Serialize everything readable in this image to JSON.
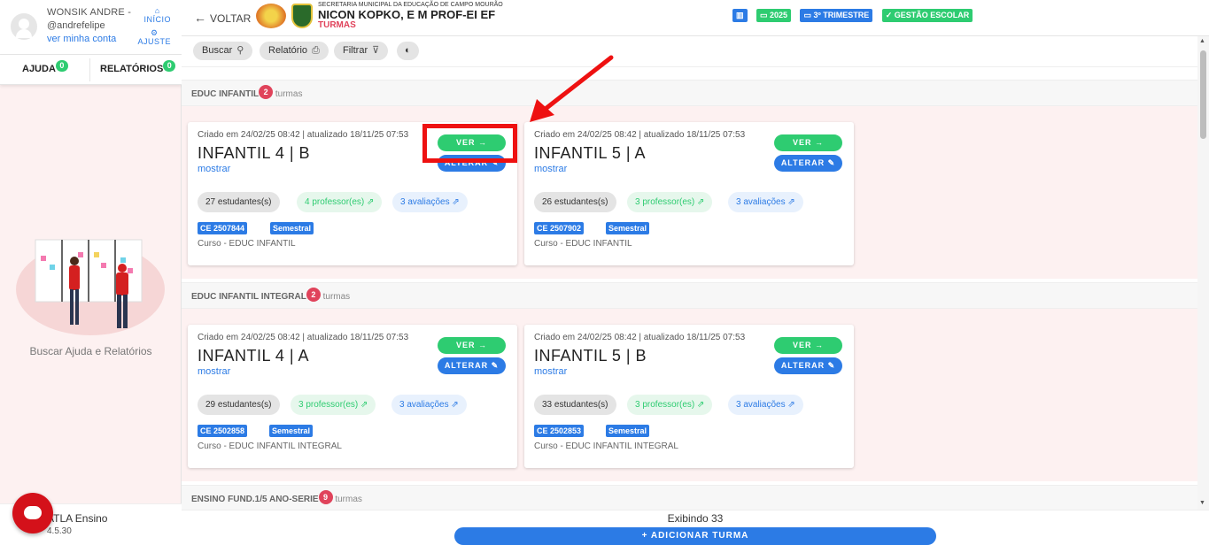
{
  "user": {
    "name": "WONSIK ANDRE -",
    "handle": "@andrefelipe",
    "profile_link": "ver minha conta"
  },
  "quick_links": {
    "home": "INÍCIO",
    "settings": "AJUSTE"
  },
  "sidebar_tabs": {
    "help": "AJUDA",
    "help_count": "0",
    "reports": "RELATÓRIOS",
    "reports_count": "0"
  },
  "help_text": "Buscar Ajuda e Relatórios",
  "app": {
    "name": "ATLA Ensino",
    "version": "4.5.30"
  },
  "header": {
    "back": "VOLTAR",
    "secretaria": "SECRETARIA MUNICIPAL DA EDUCAÇÃO DE CAMPO MOURÃO",
    "school": "NICON KOPKO, E M PROF-EI EF",
    "subtitle": "TURMAS",
    "chips": {
      "year": "2025",
      "term": "3º TRIMESTRE",
      "mgmt": "GESTÃO ESCOLAR"
    }
  },
  "toolbar": {
    "search": "Buscar",
    "report": "Relatório",
    "filter": "Filtrar"
  },
  "sections": [
    {
      "title": "EDUC INFANTIL",
      "count": "2",
      "suffix": "turmas",
      "cards": [
        {
          "meta": "Criado em 24/02/25 08:42 | atualizado 18/11/25 07:53",
          "name": "INFANTIL 4 | B",
          "more": "mostrar",
          "students": "27 estudantes(s)",
          "teachers": "4 professor(es)",
          "evals": "3 avaliações",
          "code": "CE 2507844",
          "period": "Semestral",
          "course": "Curso - EDUC INFANTIL"
        },
        {
          "meta": "Criado em 24/02/25 08:42 | atualizado 18/11/25 07:53",
          "name": "INFANTIL 5 | A",
          "more": "mostrar",
          "students": "26 estudantes(s)",
          "teachers": "3 professor(es)",
          "evals": "3 avaliações",
          "code": "CE 2507902",
          "period": "Semestral",
          "course": "Curso - EDUC INFANTIL"
        }
      ]
    },
    {
      "title": "EDUC INFANTIL INTEGRAL",
      "count": "2",
      "suffix": "turmas",
      "cards": [
        {
          "meta": "Criado em 24/02/25 08:42 | atualizado 18/11/25 07:53",
          "name": "INFANTIL 4 | A",
          "more": "mostrar",
          "students": "29 estudantes(s)",
          "teachers": "3 professor(es)",
          "evals": "3 avaliações",
          "code": "CE 2502858",
          "period": "Semestral",
          "course": "Curso - EDUC INFANTIL INTEGRAL"
        },
        {
          "meta": "Criado em 24/02/25 08:42 | atualizado 18/11/25 07:53",
          "name": "INFANTIL 5 | B",
          "more": "mostrar",
          "students": "33 estudantes(s)",
          "teachers": "3 professor(es)",
          "evals": "3 avaliações",
          "code": "CE 2502853",
          "period": "Semestral",
          "course": "Curso - EDUC INFANTIL INTEGRAL"
        }
      ]
    },
    {
      "title": "ENSINO FUND.1/5 ANO-SERIE",
      "count": "9",
      "suffix": "turmas",
      "cards": []
    }
  ],
  "card_buttons": {
    "view": "VER →",
    "edit": "ALTERAR ✎"
  },
  "footer": {
    "showing": "Exibindo 33",
    "add": "+ ADICIONAR TURMA"
  },
  "colors": {
    "accent": "#2c7be5",
    "success": "#2ecc71",
    "danger": "#e0435b",
    "highlight": "#ee1111",
    "section_bg": "#fdf1f1"
  }
}
